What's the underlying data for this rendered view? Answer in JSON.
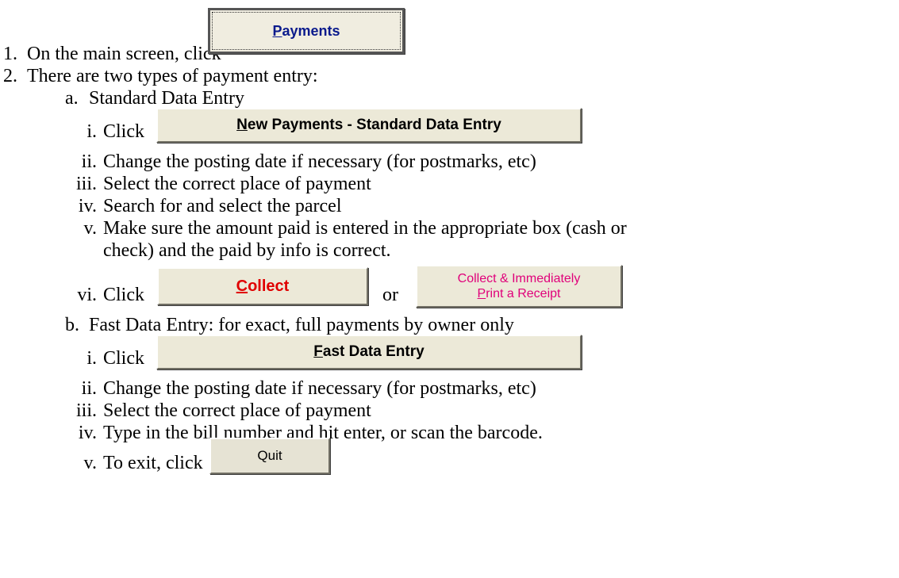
{
  "steps": [
    {
      "num": "1.",
      "text": "On the main screen, click"
    },
    {
      "num": "2.",
      "text": "There are two types of payment entry:"
    }
  ],
  "buttons": {
    "payments": {
      "accel": "P",
      "rest": "ayments"
    },
    "new_payments": {
      "accel": "N",
      "rest": "ew Payments - Standard Data Entry"
    },
    "collect": {
      "accel": "C",
      "rest": "ollect"
    },
    "collect_print_line1": "Collect & Immediately",
    "collect_print_accel": "P",
    "collect_print_rest": "rint a Receipt",
    "fast_entry": {
      "accel": "F",
      "rest": "ast Data Entry"
    },
    "quit": "Quit"
  },
  "section_a": {
    "num": "a.",
    "title": "Standard Data Entry",
    "items": [
      {
        "num": "i.",
        "text": "Click"
      },
      {
        "num": "ii.",
        "text": "Change the posting date if necessary (for postmarks, etc)"
      },
      {
        "num": "iii.",
        "text": "Select the correct place of payment"
      },
      {
        "num": "iv.",
        "text": "Search for and select the parcel"
      },
      {
        "num": "v.",
        "text": "Make sure the amount paid is entered in the appropriate box (cash or"
      },
      {
        "num": "",
        "text": "check) and the paid by info is correct."
      },
      {
        "num": "vi.",
        "text": "Click"
      }
    ],
    "or_text": "or"
  },
  "section_b": {
    "num": "b.",
    "title": "Fast Data Entry: for exact, full payments by owner only",
    "items": [
      {
        "num": "i.",
        "text": "Click"
      },
      {
        "num": "ii.",
        "text": "Change the posting date if necessary (for postmarks, etc)"
      },
      {
        "num": "iii.",
        "text": "Select the correct place of payment"
      },
      {
        "num": "iv.",
        "text": "Type in the bill number and hit enter, or scan the barcode."
      },
      {
        "num": "v.",
        "text": "To exit, click"
      }
    ]
  },
  "colors": {
    "payments_text": "#0a1a8c",
    "collect_text": "#e00000",
    "collect_print_text": "#e0007a",
    "button_face": "#ece9d8"
  }
}
